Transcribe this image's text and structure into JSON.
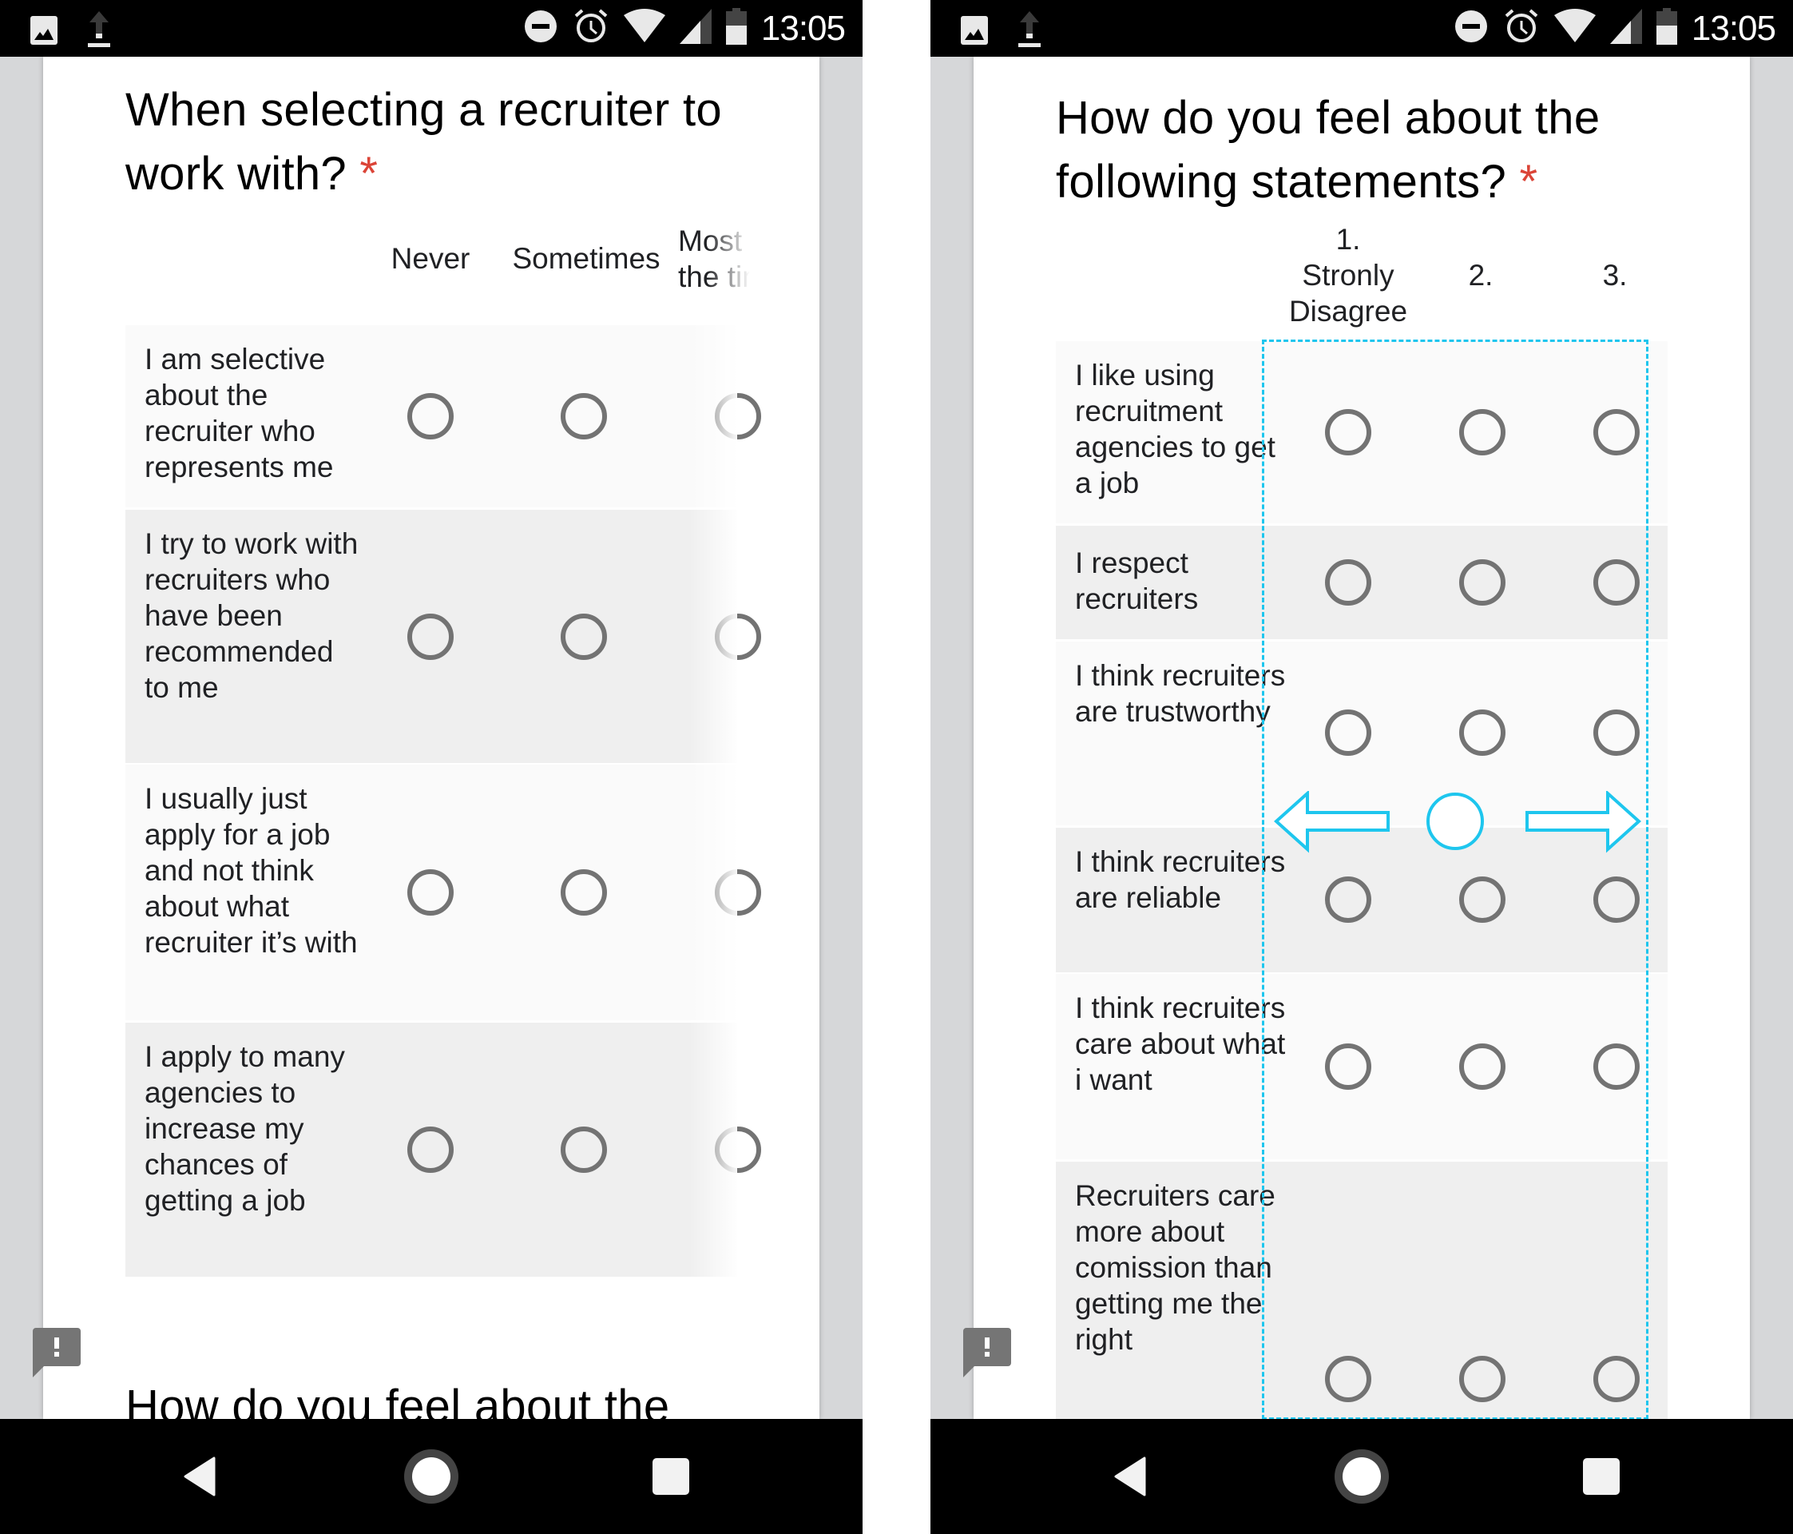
{
  "status_bar": {
    "time": "13:05",
    "left_icons": [
      "gallery-notification-icon",
      "upload-icon"
    ],
    "right_icons": [
      "do-not-disturb-icon",
      "alarm-icon",
      "wifi-icon",
      "cell-signal-icon",
      "battery-icon"
    ]
  },
  "left_screen": {
    "question": {
      "title": "When selecting a recruiter to work with?",
      "required_marker": "*",
      "columns": [
        "Never",
        "Sometimes",
        "Most of the time"
      ],
      "columns_visible": [
        "Never",
        "Sometimes",
        "Mos the"
      ],
      "rows": [
        {
          "label": "I am selective about the recruiter who represents me"
        },
        {
          "label": "I try to work with recruiters who have been recommended to me"
        },
        {
          "label": "I usually just apply for a job and not think about what recruiter it’s with"
        },
        {
          "label": "I apply to many agencies to increase my chances of getting a job"
        }
      ]
    },
    "next_question_title_partial": "How do you feel about the"
  },
  "right_screen": {
    "question": {
      "title": "How do you feel about the following statements?",
      "required_marker": "*",
      "columns": [
        "1. Stronly Disagree",
        "2.",
        "3."
      ],
      "column_lines": [
        [
          "1.",
          "Stronly",
          "Disagree"
        ],
        [
          "2."
        ],
        [
          "3."
        ]
      ],
      "rows": [
        {
          "label": "I like using recruitment agencies to get a job"
        },
        {
          "label": "I respect recruiters"
        },
        {
          "label": "I think recruiters are trustworthy"
        },
        {
          "label": "I think recruiters are reliable"
        },
        {
          "label": "I think recruiters care about what i want"
        },
        {
          "label": "Recruiters care more about comission than getting me the right"
        }
      ]
    },
    "annotation": {
      "description": "horizontal swipe gesture hint over scrollable grid",
      "color": "#1ec6ee"
    }
  },
  "nav_bar": {
    "back": "back-button",
    "home": "home-button",
    "recents": "recents-button"
  },
  "colors": {
    "required": "#db4437",
    "radio_border": "#737373",
    "row_odd": "#fafafa",
    "row_even": "#efefef",
    "hint": "#1ec6ee"
  }
}
